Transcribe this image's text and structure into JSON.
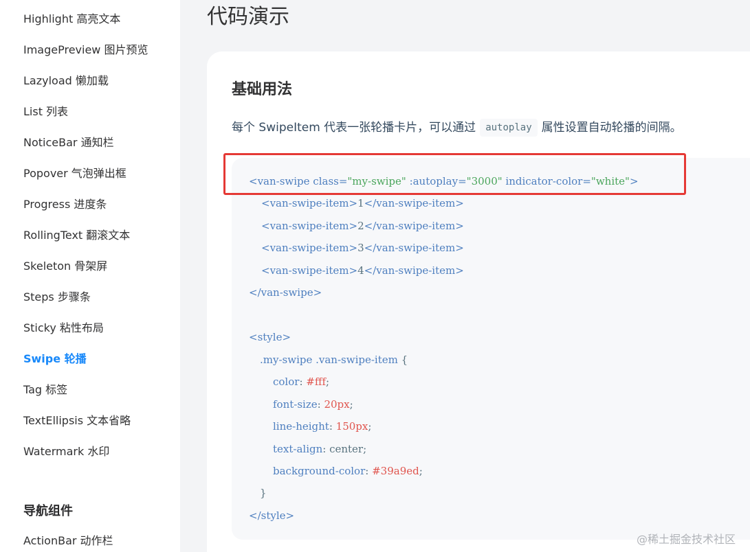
{
  "sidebar": {
    "items": [
      {
        "label": "Highlight 高亮文本"
      },
      {
        "label": "ImagePreview 图片预览"
      },
      {
        "label": "Lazyload 懒加载"
      },
      {
        "label": "List 列表"
      },
      {
        "label": "NoticeBar 通知栏"
      },
      {
        "label": "Popover 气泡弹出框"
      },
      {
        "label": "Progress 进度条"
      },
      {
        "label": "RollingText 翻滚文本"
      },
      {
        "label": "Skeleton 骨架屏"
      },
      {
        "label": "Steps 步骤条"
      },
      {
        "label": "Sticky 粘性布局"
      },
      {
        "label": "Swipe 轮播"
      },
      {
        "label": "Tag 标签"
      },
      {
        "label": "TextEllipsis 文本省略"
      },
      {
        "label": "Watermark 水印"
      }
    ],
    "active_index": 11,
    "group_title": "导航组件",
    "group_items": [
      {
        "label": "ActionBar 动作栏"
      }
    ]
  },
  "main": {
    "page_title": "代码演示",
    "section_title": "基础用法",
    "description_before": "每个 SwipeItem 代表一张轮播卡片，可以通过",
    "description_code": "autoplay",
    "description_after": "属性设置自动轮播的间隔。",
    "code": {
      "l1_open": "<van-swipe ",
      "l1_attr1": "class=",
      "l1_val1": "\"my-swipe\"",
      "l1_attr2": " :autoplay=",
      "l1_val2": "\"3000\"",
      "l1_attr3": " indicator-color=",
      "l1_val3": "\"white\"",
      "l1_close": ">",
      "items": [
        {
          "open": "<van-swipe-item>",
          "text": "1",
          "close": "</van-swipe-item>"
        },
        {
          "open": "<van-swipe-item>",
          "text": "2",
          "close": "</van-swipe-item>"
        },
        {
          "open": "<van-swipe-item>",
          "text": "3",
          "close": "</van-swipe-item>"
        },
        {
          "open": "<van-swipe-item>",
          "text": "4",
          "close": "</van-swipe-item>"
        }
      ],
      "swipe_close": "</van-swipe>",
      "style_open": "<style>",
      "selector": ".my-swipe .van-swipe-item ",
      "brace_open": "{",
      "props": [
        {
          "name": "color",
          "value": "#fff",
          "value_color": "red"
        },
        {
          "name": "font-size",
          "value": "20px",
          "value_color": "red"
        },
        {
          "name": "line-height",
          "value": "150px",
          "value_color": "red"
        },
        {
          "name": "text-align",
          "value": "center",
          "value_color": "plain"
        },
        {
          "name": "background-color",
          "value": "#39a9ed",
          "value_color": "red"
        }
      ],
      "brace_close": "}",
      "style_close": "</style>"
    }
  },
  "watermark": "@稀土掘金技术社区",
  "colors": {
    "accent": "#1989fa",
    "highlight_border": "#e53935"
  }
}
